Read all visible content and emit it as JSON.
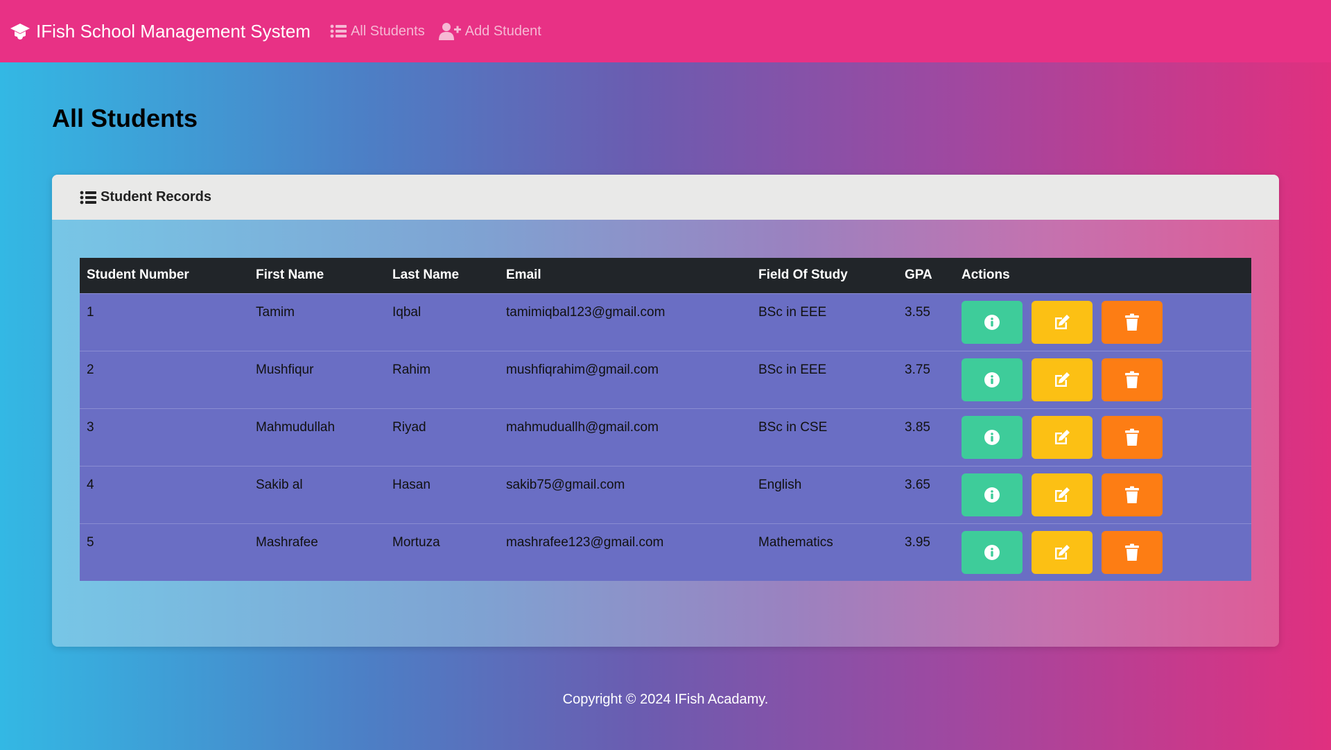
{
  "navbar": {
    "brand": "IFish School Management System",
    "links": [
      {
        "label": "All Students",
        "icon": "list-icon"
      },
      {
        "label": "Add Student",
        "icon": "user-plus-icon"
      }
    ]
  },
  "page_title": "All Students",
  "card": {
    "header": "Student Records"
  },
  "table": {
    "headers": [
      "Student Number",
      "First Name",
      "Last Name",
      "Email",
      "Field Of Study",
      "GPA",
      "Actions"
    ],
    "rows": [
      {
        "number": "1",
        "first": "Tamim",
        "last": "Iqbal",
        "email": "tamimiqbal123@gmail.com",
        "field": "BSc in EEE",
        "gpa": "3.55"
      },
      {
        "number": "2",
        "first": "Mushfiqur",
        "last": "Rahim",
        "email": "mushfiqrahim@gmail.com",
        "field": "BSc in EEE",
        "gpa": "3.75"
      },
      {
        "number": "3",
        "first": "Mahmudullah",
        "last": "Riyad",
        "email": "mahmuduallh@gmail.com",
        "field": "BSc in CSE",
        "gpa": "3.85"
      },
      {
        "number": "4",
        "first": "Sakib al",
        "last": "Hasan",
        "email": "sakib75@gmail.com",
        "field": "English",
        "gpa": "3.65"
      },
      {
        "number": "5",
        "first": "Mashrafee",
        "last": "Mortuza",
        "email": "mashrafee123@gmail.com",
        "field": "Mathematics",
        "gpa": "3.95"
      }
    ],
    "action_icons": [
      "info-icon",
      "edit-icon",
      "trash-icon"
    ]
  },
  "colors": {
    "navbar": "#e83185",
    "info": "#3ecc9a",
    "edit": "#fcc014",
    "delete": "#fd7d14",
    "table_header": "#212529",
    "row": "#6a6ec4"
  },
  "footer": "Copyright © 2024 IFish Acadamy."
}
